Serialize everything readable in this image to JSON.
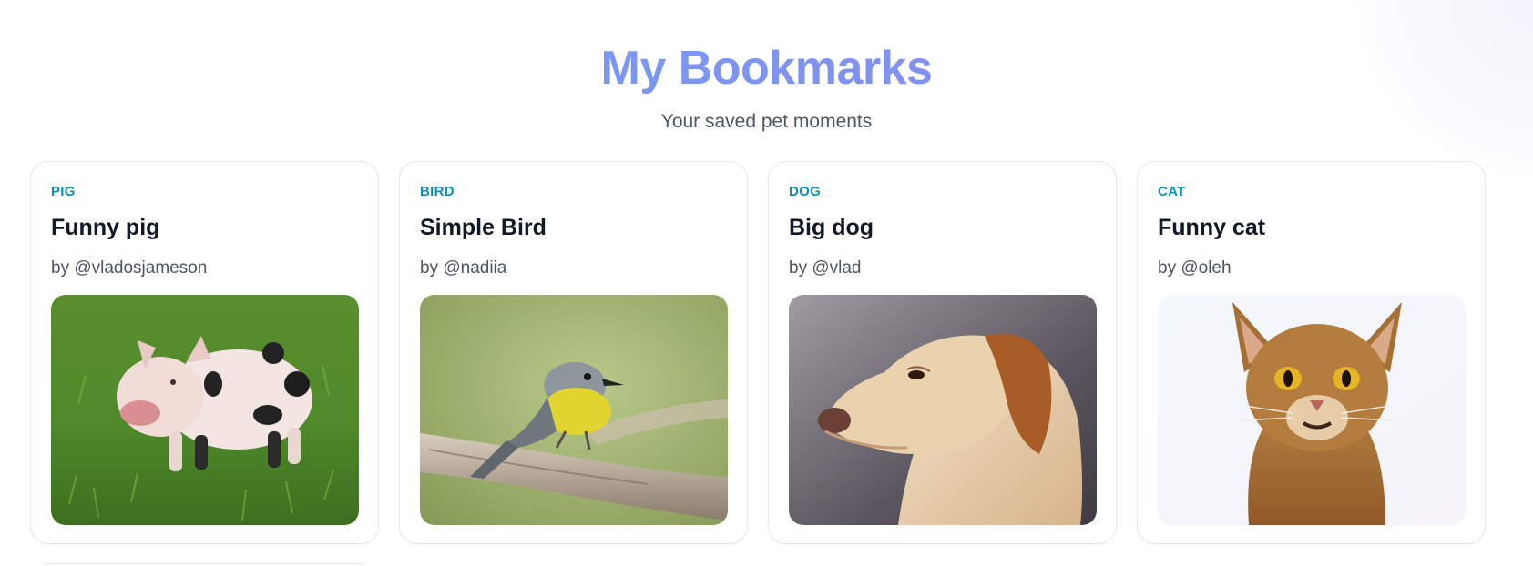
{
  "header": {
    "title": "My Bookmarks",
    "subtitle": "Your saved pet moments"
  },
  "bookmarks": [
    {
      "category": "PIG",
      "title": "Funny pig",
      "author": "by @vladosjameson",
      "image_icon": "pig-photo"
    },
    {
      "category": "BIRD",
      "title": "Simple Bird",
      "author": "by @nadiia",
      "image_icon": "bird-photo"
    },
    {
      "category": "DOG",
      "title": "Big dog",
      "author": "by @vlad",
      "image_icon": "dog-photo"
    },
    {
      "category": "CAT",
      "title": "Funny cat",
      "author": "by @oleh",
      "image_icon": "cat-photo"
    }
  ],
  "colors": {
    "title_gradient_start": "#6fa2f6",
    "title_gradient_end": "#8e86ef",
    "category": "#0e8fb6",
    "card_border": "#e5e7eb"
  }
}
